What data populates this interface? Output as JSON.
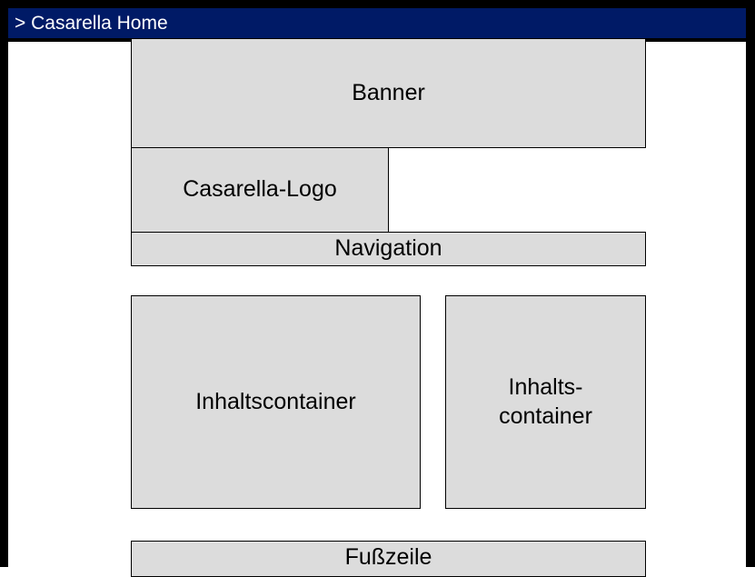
{
  "window": {
    "title": "> Casarella Home"
  },
  "layout_blocks": {
    "banner": "Banner",
    "logo": "Casarella-Logo",
    "navigation": "Navigation",
    "content_main": "Inhaltscontainer",
    "content_side_line1": "Inhalts-",
    "content_side_line2": "container",
    "footer": "Fußzeile"
  },
  "colors": {
    "titlebar": "#001a66",
    "box_fill": "#dcdcdc",
    "border": "#000000"
  }
}
